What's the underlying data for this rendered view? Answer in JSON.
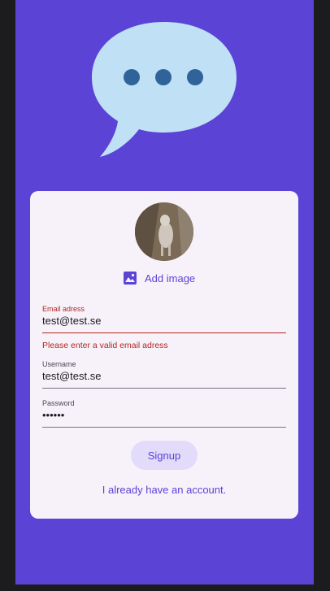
{
  "app": {
    "add_image_label": "Add image",
    "email": {
      "label": "Email adress",
      "value": "test@test.se",
      "error": "Please enter a valid email adress"
    },
    "username": {
      "label": "Username",
      "value": "test@test.se"
    },
    "password": {
      "label": "Password",
      "value": "••••••"
    },
    "signup_label": "Signup",
    "login_link": "I already have an account."
  },
  "colors": {
    "background": "#5b43d6",
    "card": "#f7f2fa",
    "accent": "#5b43d6",
    "error": "#b3261e",
    "bubble": "#bfe0f5",
    "bubble_dots": "#2f6399"
  },
  "icons": [
    "chat-bubble-icon",
    "image-icon"
  ]
}
